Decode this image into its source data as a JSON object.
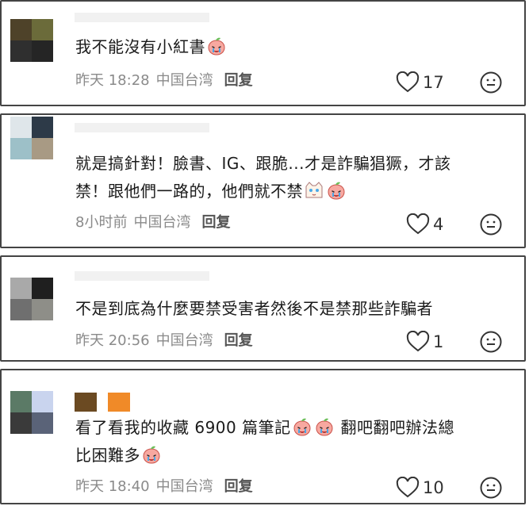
{
  "colors": {
    "meta": "#8a8a8a",
    "text": "#1a1a1a",
    "border": "#444444"
  },
  "comments": [
    {
      "avatar_colors": [
        "#4e4229",
        "#6b6b3a",
        "#2f2f2f",
        "#252525"
      ],
      "text_parts": [
        "我不能沒有小紅書"
      ],
      "time": "昨天 18:28",
      "location": "中国台湾",
      "reply": "回复",
      "likes": "17"
    },
    {
      "avatar_colors": [
        "#dfe6ea",
        "#2d3a48",
        "#9dc0c8",
        "#a89a84"
      ],
      "text_line1": "就是搞針對！臉書、IG、跟脆...才是詐騙猖獗，才該",
      "text_line2": "禁！跟他們一路的，他們就不禁",
      "time": "8小时前",
      "location": "中国台湾",
      "reply": "回复",
      "likes": "4"
    },
    {
      "avatar_colors": [
        "#a9a9a9",
        "#1f1f1f",
        "#6f6f6f",
        "#8e8e88"
      ],
      "text_parts": [
        "不是到底為什麼要禁受害者然後不是禁那些詐騙者"
      ],
      "time": "昨天 20:56",
      "location": "中国台湾",
      "reply": "回复",
      "likes": "1"
    },
    {
      "avatar_colors": [
        "#5b7a66",
        "#c9d4ee",
        "#3a3a3a",
        "#5a6378"
      ],
      "name_block_colors": [
        "#6b4a22",
        "#f08a28"
      ],
      "text_line1a": "看了看我的收藏 6900 篇筆記",
      "text_line1b": "翻吧翻吧辦法總",
      "text_line2": "比困難多",
      "time": "昨天 18:40",
      "location": "中国台湾",
      "reply": "回复",
      "likes": "10"
    }
  ],
  "icons": {
    "like": "heart-outline-icon",
    "sticker": "smiley-face-icon",
    "emoji": "crying-peach-emoji"
  }
}
